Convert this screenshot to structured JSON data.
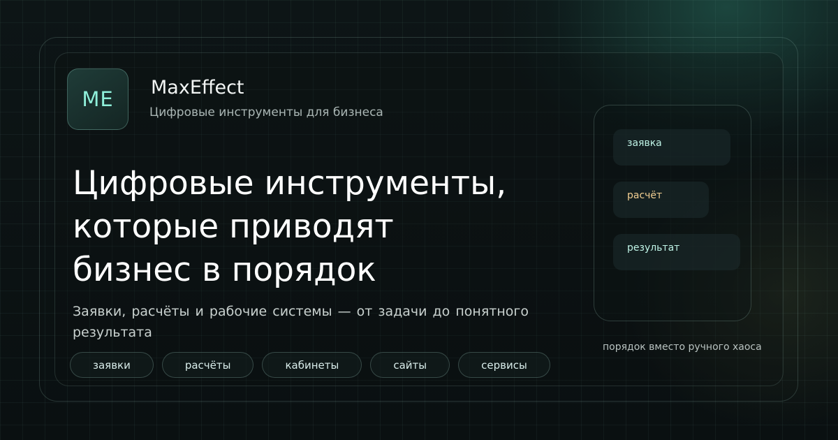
{
  "brand": {
    "logo_initials": "ME",
    "name": "MaxEffect",
    "tagline": "Цифровые инструменты для бизнеса"
  },
  "hero": {
    "headline_lines": [
      "Цифровые инструменты,",
      "которые приводят",
      "бизнес в порядок"
    ],
    "subtitle": "Заявки, расчёты и рабочие системы — от задачи до понятного результата"
  },
  "tags": [
    "заявки",
    "расчёты",
    "кабинеты",
    "сайты",
    "сервисы"
  ],
  "flow": {
    "steps": [
      "заявка",
      "расчёт",
      "результат"
    ],
    "caption": "порядок вместо ручного хаоса"
  },
  "colors": {
    "accent_mint": "#8ff0da",
    "accent_amber": "#f3cf92",
    "background": "#0b1112"
  }
}
